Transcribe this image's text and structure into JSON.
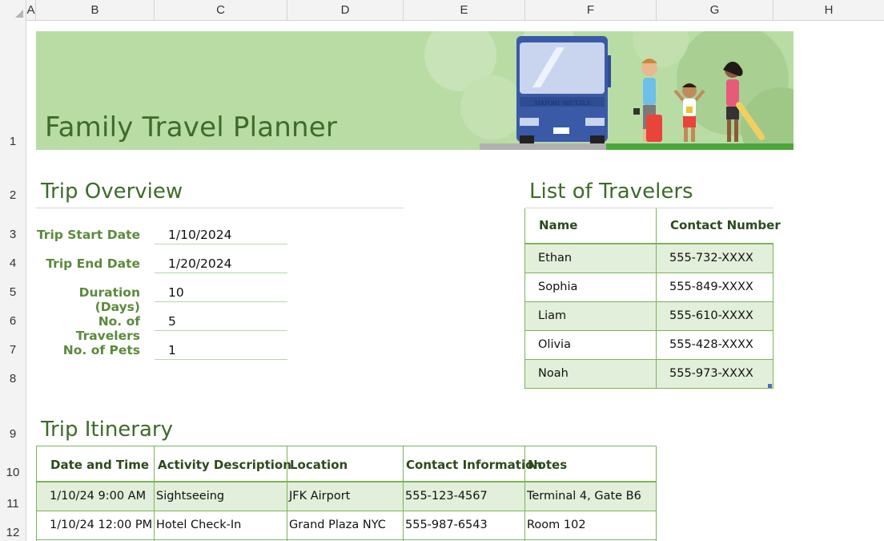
{
  "columns": [
    "A",
    "B",
    "C",
    "D",
    "E",
    "F",
    "G",
    "H"
  ],
  "rows": [
    "1",
    "2",
    "3",
    "4",
    "5",
    "6",
    "7",
    "8",
    "9",
    "10",
    "11",
    "12"
  ],
  "banner": {
    "title": "Family Travel Planner",
    "bus_text": "AIRPORT SHUTTLE"
  },
  "overview": {
    "title": "Trip Overview",
    "items": [
      {
        "label": "Trip Start Date",
        "value": "1/10/2024"
      },
      {
        "label": "Trip End Date",
        "value": "1/20/2024"
      },
      {
        "label": "Duration (Days)",
        "value": "10"
      },
      {
        "label": "No. of Travelers",
        "value": "5"
      },
      {
        "label": "No. of Pets",
        "value": "1"
      }
    ]
  },
  "travelers": {
    "title": "List of Travelers",
    "headers": {
      "name": "Name",
      "contact": "Contact Number"
    },
    "rows": [
      {
        "name": "Ethan",
        "contact": "555-732-XXXX"
      },
      {
        "name": "Sophia",
        "contact": "555-849-XXXX"
      },
      {
        "name": "Liam",
        "contact": "555-610-XXXX"
      },
      {
        "name": "Olivia",
        "contact": "555-428-XXXX"
      },
      {
        "name": "Noah",
        "contact": "555-973-XXXX"
      }
    ]
  },
  "itinerary": {
    "title": "Trip Itinerary",
    "headers": {
      "date": "Date and Time",
      "activity": "Activity Description",
      "location": "Location",
      "contact": "Contact Information",
      "notes": "Notes"
    },
    "rows": [
      {
        "date": "1/10/24 9:00 AM",
        "activity": "Sightseeing",
        "location": "JFK Airport",
        "contact": "555-123-4567",
        "notes": "Terminal 4, Gate B6"
      },
      {
        "date": "1/10/24 12:00 PM",
        "activity": "Hotel Check-In",
        "location": "Grand Plaza NYC",
        "contact": "555-987-6543",
        "notes": "Room 102"
      }
    ]
  },
  "colors": {
    "banner_bg": "#b9dca5",
    "title_green": "#3e6b2a",
    "label_green": "#5b8a3c",
    "band": "#e2efda",
    "border": "#7cb35a"
  }
}
